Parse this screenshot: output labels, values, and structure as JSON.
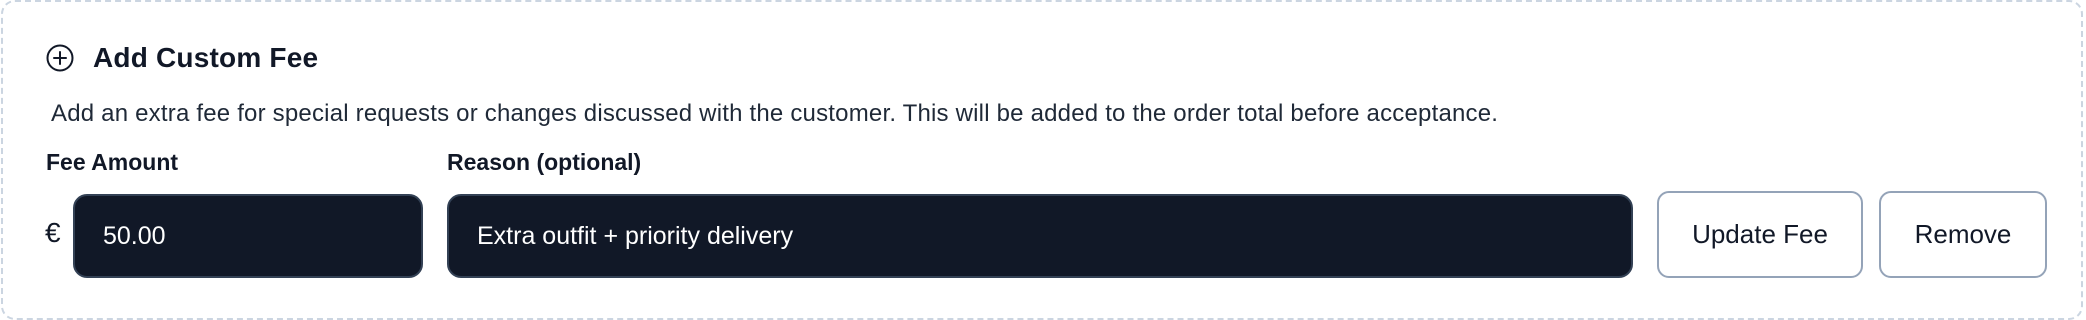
{
  "section": {
    "icon": "plus-circle-icon",
    "title": "Add Custom Fee",
    "description": "Add an extra fee for special requests or changes discussed with the customer. This will be added to the order total before acceptance."
  },
  "fee": {
    "label": "Fee Amount",
    "currency": "€",
    "value": "50.00"
  },
  "reason": {
    "label": "Reason (optional)",
    "value": "Extra outfit + priority delivery"
  },
  "buttons": {
    "update": "Update Fee",
    "remove": "Remove"
  },
  "colors": {
    "input_bg": "#111827",
    "text": "#111827",
    "border": "#94a3b8"
  }
}
